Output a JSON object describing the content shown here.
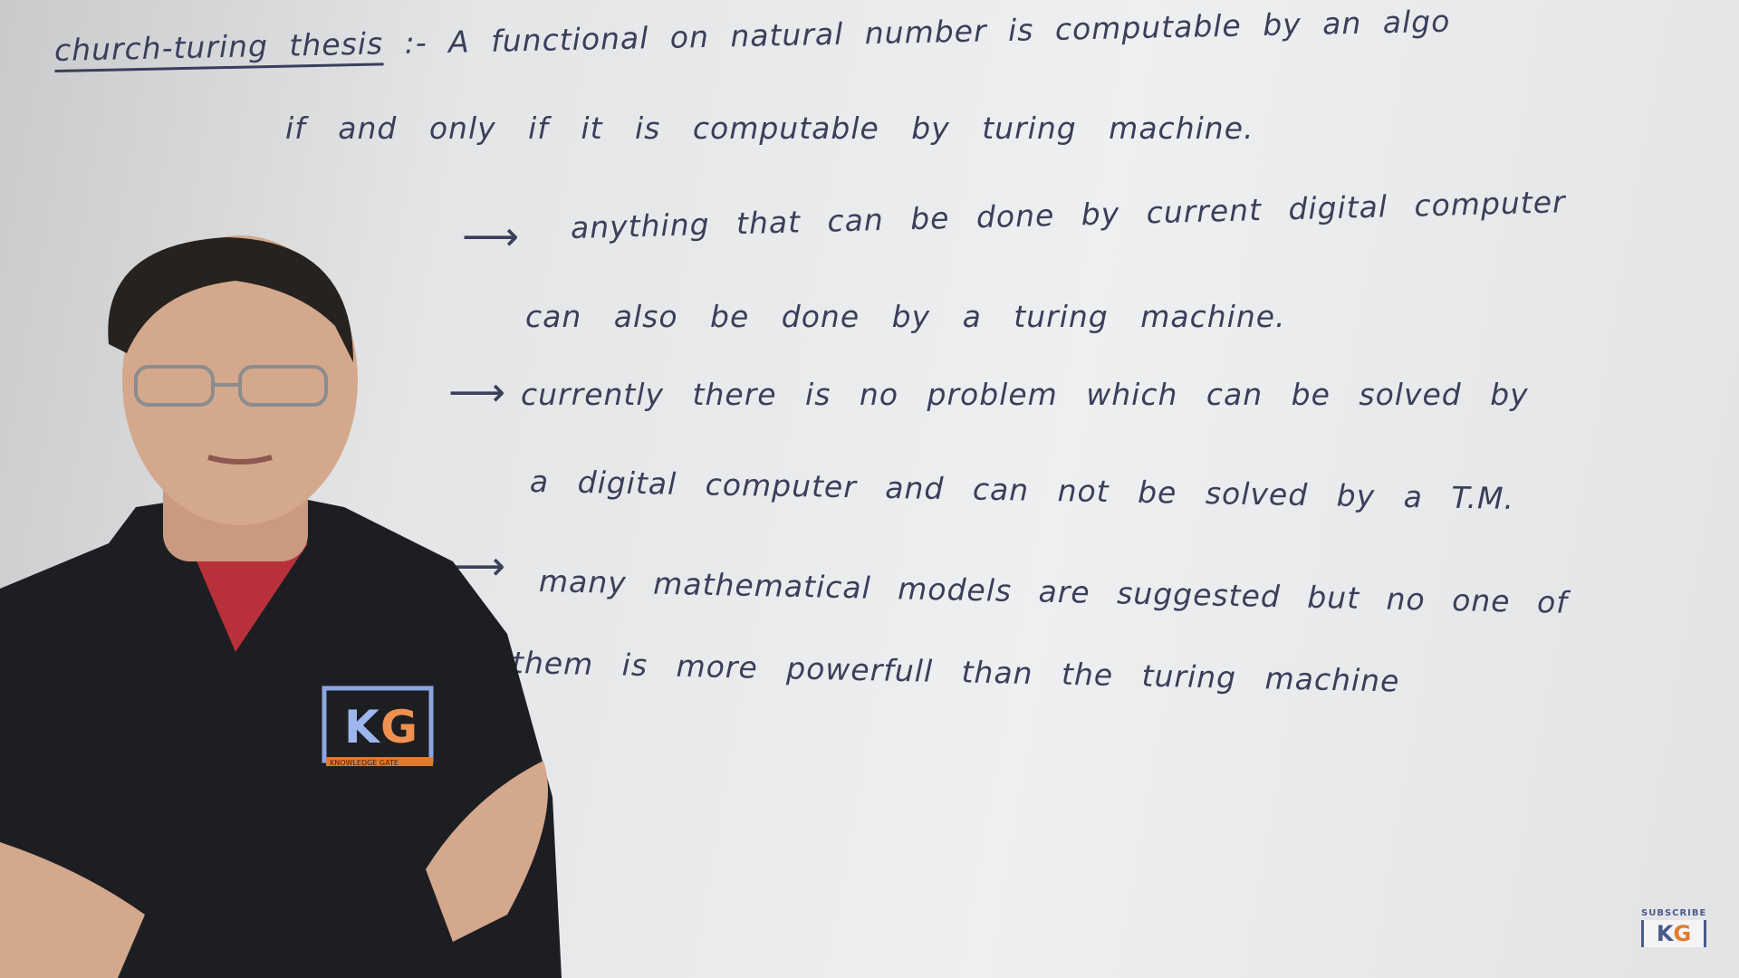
{
  "board": {
    "title": "church-turing thesis",
    "line1": ":- A functional on natural number is computable by an algo",
    "line2": "if and only if it is computable by turing machine.",
    "point1_a": "anything that can be done by current digital computer",
    "point1_b": "can also be done by a turing machine.",
    "point2_a": "currently there is no problem which can be solved by",
    "point2_b": "a digital computer and can not be solved by a T.M.",
    "point3_a": "many mathematical models are suggested but no one of",
    "point3_b": "them is more powerfull than the turing machine",
    "arrow": "⟶"
  },
  "shirt_logo": {
    "k": "K",
    "g": "G",
    "sub": "KNOWLEDGE GATE"
  },
  "subscribe": {
    "label": "SUBSCRIBE",
    "k": "K",
    "g": "G"
  },
  "colors": {
    "ink": "#3a3f5a",
    "brand_blue": "#4a5a8a",
    "brand_orange": "#e07a30"
  }
}
